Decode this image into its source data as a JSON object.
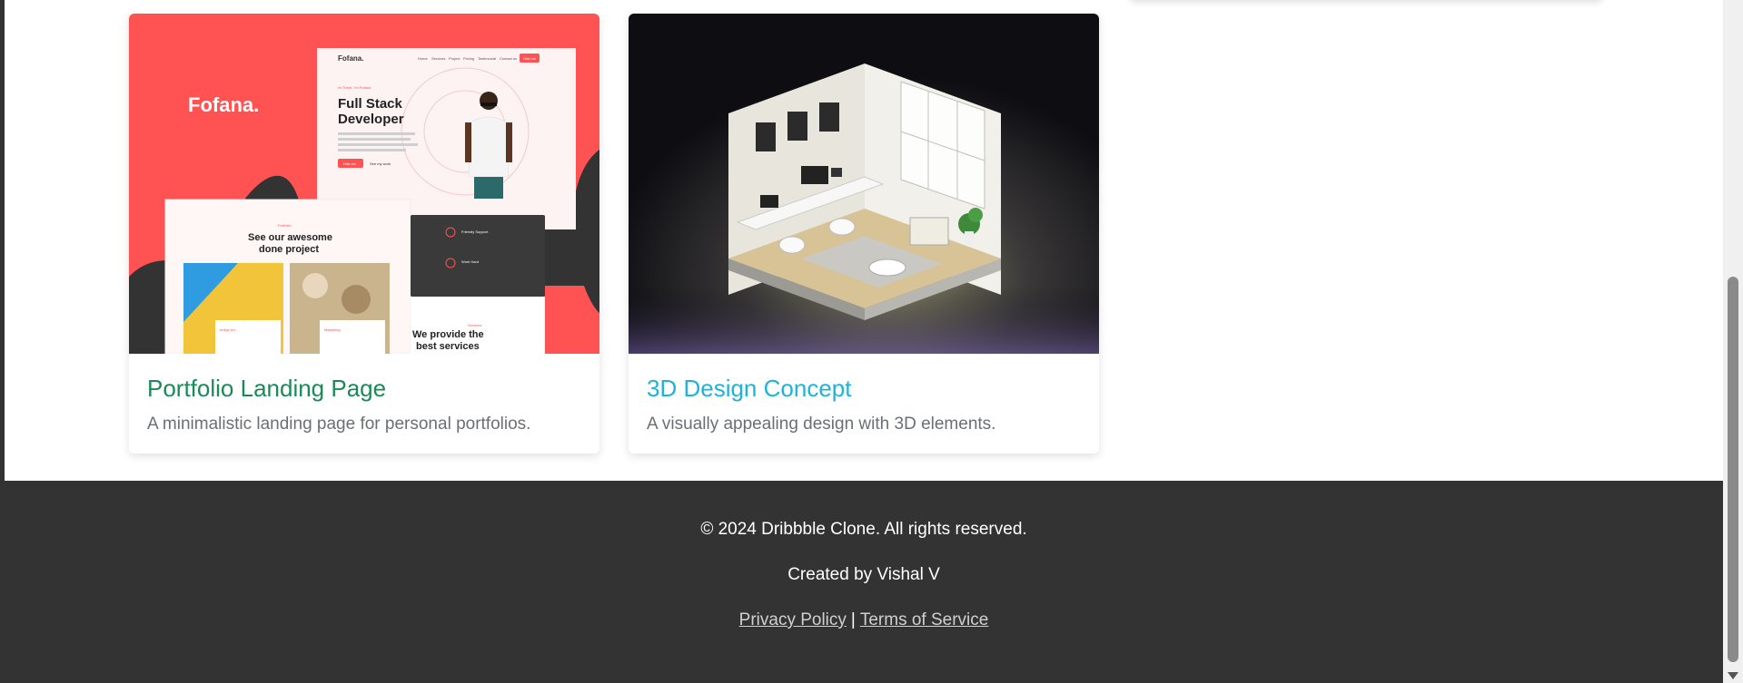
{
  "cards": [
    {
      "title": "Portfolio Landing Page",
      "description": "A minimalistic landing page for personal portfolios.",
      "thumb": {
        "brand": "Fofana.",
        "nav_brand": "Fofana.",
        "nav_items": [
          "Home",
          "Services",
          "Project",
          "Pricing",
          "Testimonial",
          "Contact us"
        ],
        "nav_button": "Hire me",
        "eyebrow": "Hi There, I'm Fofana",
        "heading_line1": "Full Stack",
        "heading_line2": "Developer",
        "hero_primary": "Hire me",
        "hero_secondary": "See my work",
        "portfolio_eyebrow": "Portfolio",
        "portfolio_heading_line1": "See our awesome",
        "portfolio_heading_line2": "done project",
        "feature1": "Friendly Support",
        "feature2": "Work Hard",
        "tile1": "Indigo Art",
        "tile2": "Marketing",
        "services_eyebrow": "Services",
        "services_heading_line1": "We provide the",
        "services_heading_line2": "best services"
      }
    },
    {
      "title": "3D Design Concept",
      "description": "A visually appealing design with 3D elements."
    }
  ],
  "footer": {
    "copyright": "© 2024 Dribbble Clone. All rights reserved.",
    "credit": "Created by Vishal V",
    "privacy": "Privacy Policy",
    "separator": "|",
    "terms": "Terms of Service"
  },
  "colors": {
    "card1_title": "#1a8a57",
    "card2_title": "#1eb3d8",
    "footer_bg": "#333333",
    "brand_red": "#ff5252"
  }
}
